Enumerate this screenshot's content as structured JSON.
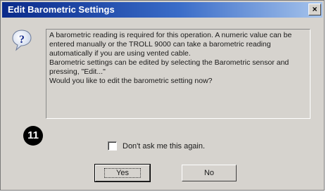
{
  "window": {
    "title": "Edit Barometric Settings",
    "close_glyph": "×"
  },
  "icon": "question-icon",
  "message": {
    "paragraph1": "A barometric reading is required for this operation. A numeric value can be entered manually or the TROLL 9000 can take a barometric reading automatically if you are using vented cable.",
    "paragraph2": "Barometric settings can be edited by selecting the Barometric sensor and pressing, \"Edit...\"",
    "paragraph3": "Would you like to edit the barometric setting now?"
  },
  "step_badge": "11",
  "checkbox": {
    "label": "Don't ask me this again.",
    "checked": false
  },
  "buttons": {
    "yes": "Yes",
    "no": "No"
  },
  "colors": {
    "titlebar_start": "#0a2a8a",
    "titlebar_end": "#a6c4ec",
    "dialog_bg": "#d6d3ce"
  }
}
